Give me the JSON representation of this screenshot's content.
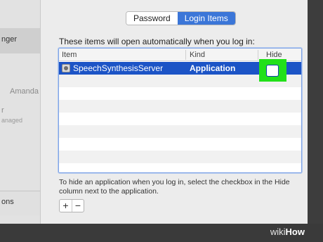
{
  "sidebar": {
    "items": [
      {
        "label": "nger"
      },
      {
        "label": "Amanda"
      },
      {
        "label": "r"
      },
      {
        "label": "anaged"
      },
      {
        "label": "ons"
      }
    ]
  },
  "tabs": [
    {
      "label": "Password",
      "selected": false
    },
    {
      "label": "Login Items",
      "selected": true
    }
  ],
  "intro_text": "These items will open automatically when you log in:",
  "table": {
    "columns": [
      "Item",
      "Kind",
      "Hide"
    ],
    "rows": [
      {
        "item": "SpeechSynthesisServer",
        "kind": "Application",
        "hide": false,
        "selected": true
      }
    ]
  },
  "help_text": "To hide an application when you log in, select the checkbox in the Hide column next to the application.",
  "buttons": {
    "add": "+",
    "remove": "−"
  },
  "watermark": {
    "prefix": "wiki",
    "suffix": "How"
  },
  "colors": {
    "accent": "#3b76d8",
    "selection": "#1c54c6",
    "highlight": "#22e019"
  }
}
